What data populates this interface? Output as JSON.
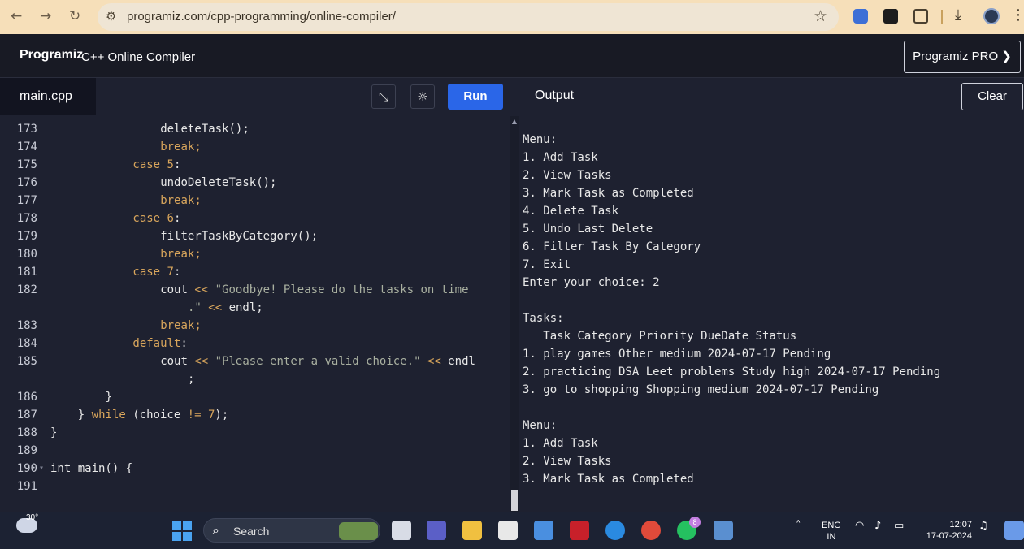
{
  "browser": {
    "url": "programiz.com/cpp-programming/online-compiler/",
    "icons": [
      "back-arrow-icon",
      "forward-arrow-icon",
      "reload-icon",
      "site-settings-icon",
      "bookmark-star-icon",
      "extension-icon",
      "puzzle-icon",
      "download-icon",
      "profile-icon",
      "more-icon"
    ]
  },
  "site": {
    "logo": "Programiz",
    "title": "C++ Online Compiler",
    "pro_button": "Programiz PRO ❯"
  },
  "editor": {
    "filename": "main.cpp",
    "run_label": "Run",
    "lines": [
      {
        "n": "173",
        "code": [
          {
            "t": "deleteTask();",
            "c": ""
          }
        ],
        "indent": 16
      },
      {
        "n": "174",
        "code": [
          {
            "t": "break;",
            "c": "kw"
          }
        ],
        "indent": 16
      },
      {
        "n": "175",
        "code": [
          {
            "t": "case ",
            "c": "kw"
          },
          {
            "t": "5",
            "c": "num"
          },
          {
            "t": ":",
            "c": ""
          }
        ],
        "indent": 12
      },
      {
        "n": "176",
        "code": [
          {
            "t": "undoDeleteTask();",
            "c": ""
          }
        ],
        "indent": 16
      },
      {
        "n": "177",
        "code": [
          {
            "t": "break;",
            "c": "kw"
          }
        ],
        "indent": 16
      },
      {
        "n": "178",
        "code": [
          {
            "t": "case ",
            "c": "kw"
          },
          {
            "t": "6",
            "c": "num"
          },
          {
            "t": ":",
            "c": ""
          }
        ],
        "indent": 12
      },
      {
        "n": "179",
        "code": [
          {
            "t": "filterTaskByCategory();",
            "c": ""
          }
        ],
        "indent": 16
      },
      {
        "n": "180",
        "code": [
          {
            "t": "break;",
            "c": "kw"
          }
        ],
        "indent": 16
      },
      {
        "n": "181",
        "code": [
          {
            "t": "case ",
            "c": "kw"
          },
          {
            "t": "7",
            "c": "num"
          },
          {
            "t": ":",
            "c": ""
          }
        ],
        "indent": 12
      },
      {
        "n": "182",
        "code": [
          {
            "t": "cout ",
            "c": ""
          },
          {
            "t": "<< ",
            "c": "kw"
          },
          {
            "t": "\"Goodbye! Please do the tasks on time",
            "c": "str"
          }
        ],
        "indent": 16
      },
      {
        "n": "",
        "code": [
          {
            "t": ".\"",
            "c": "str"
          },
          {
            "t": " << ",
            "c": "kw"
          },
          {
            "t": "endl;",
            "c": ""
          }
        ],
        "indent": 20
      },
      {
        "n": "183",
        "code": [
          {
            "t": "break;",
            "c": "kw"
          }
        ],
        "indent": 16
      },
      {
        "n": "184",
        "code": [
          {
            "t": "default",
            "c": "kw"
          },
          {
            "t": ":",
            "c": ""
          }
        ],
        "indent": 12
      },
      {
        "n": "185",
        "code": [
          {
            "t": "cout ",
            "c": ""
          },
          {
            "t": "<< ",
            "c": "kw"
          },
          {
            "t": "\"Please enter a valid choice.\"",
            "c": "str"
          },
          {
            "t": " << ",
            "c": "kw"
          },
          {
            "t": "endl",
            "c": ""
          }
        ],
        "indent": 16
      },
      {
        "n": "",
        "code": [
          {
            "t": ";",
            "c": ""
          }
        ],
        "indent": 20
      },
      {
        "n": "186",
        "code": [
          {
            "t": "}",
            "c": ""
          }
        ],
        "indent": 8
      },
      {
        "n": "187",
        "code": [
          {
            "t": "} ",
            "c": ""
          },
          {
            "t": "while",
            "c": "kw"
          },
          {
            "t": " (choice ",
            "c": ""
          },
          {
            "t": "!=",
            "c": "kw"
          },
          {
            "t": " ",
            "c": ""
          },
          {
            "t": "7",
            "c": "num"
          },
          {
            "t": ");",
            "c": ""
          }
        ],
        "indent": 4
      },
      {
        "n": "188",
        "code": [
          {
            "t": "}",
            "c": ""
          }
        ],
        "indent": 0
      },
      {
        "n": "189",
        "code": [],
        "indent": 0
      },
      {
        "n": "190",
        "code": [
          {
            "t": "int main() {",
            "c": ""
          }
        ],
        "indent": 0,
        "fold": true
      },
      {
        "n": "191",
        "code": [],
        "indent": 0
      }
    ]
  },
  "output": {
    "title": "Output",
    "clear_label": "Clear",
    "lines": [
      "Menu:",
      "1. Add Task",
      "2. View Tasks",
      "3. Mark Task as Completed",
      "4. Delete Task",
      "5. Undo Last Delete",
      "6. Filter Task By Category",
      "7. Exit",
      "Enter your choice: 2",
      "",
      "Tasks:",
      "   Task Category Priority DueDate Status",
      "1. play games Other medium 2024-07-17 Pending",
      "2. practicing DSA Leet problems Study high 2024-07-17 Pending",
      "3. go to shopping Shopping medium 2024-07-17 Pending",
      "",
      "Menu:",
      "1. Add Task",
      "2. View Tasks",
      "3. Mark Task as Completed"
    ]
  },
  "taskbar": {
    "temperature": "30°",
    "search_label": "Search",
    "whatsapp_badge": "8",
    "lang_top": "ENG",
    "lang_bottom": "IN",
    "time": "12:07",
    "date": "17-07-2024"
  }
}
